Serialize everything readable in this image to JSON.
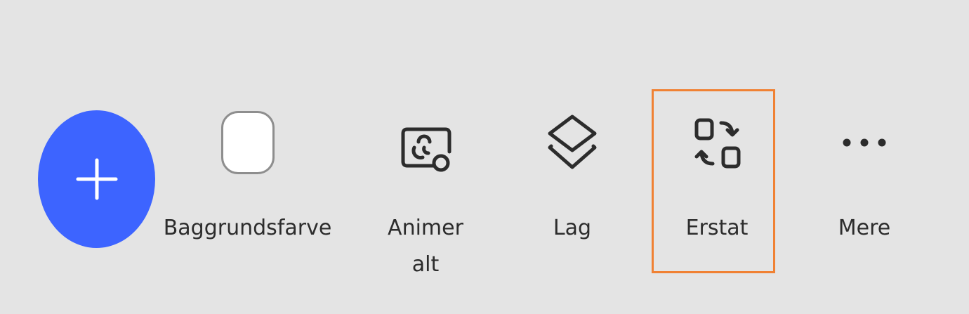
{
  "colors": {
    "background": "#e4e4e4",
    "accent": "#3d64ff",
    "highlight": "#f08133",
    "text": "#2c2c2c"
  },
  "toolbar": {
    "add_icon": "plus-icon",
    "items": [
      {
        "label": "Baggrundsfarve",
        "icon": "color-swatch-icon"
      },
      {
        "label_line1": "Animer",
        "label_line2": "alt",
        "icon": "animate-icon"
      },
      {
        "label": "Lag",
        "icon": "layers-icon"
      },
      {
        "label": "Erstat",
        "icon": "replace-icon",
        "highlighted": true
      },
      {
        "label": "Mere",
        "icon": "more-icon"
      }
    ]
  }
}
